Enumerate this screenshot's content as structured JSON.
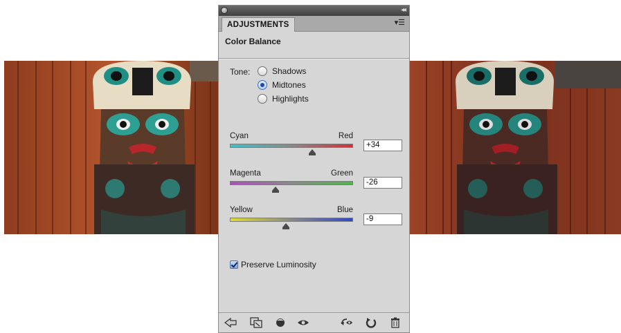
{
  "panel": {
    "tab_label": "ADJUSTMENTS",
    "section_title": "Color Balance",
    "tone_label": "Tone:",
    "tone_options": [
      "Shadows",
      "Midtones",
      "Highlights"
    ],
    "tone_selected": "Midtones",
    "sliders": [
      {
        "left": "Cyan",
        "right": "Red",
        "value": "+34",
        "level": 34,
        "colors": [
          "#3fc0c8",
          "#d0303a"
        ]
      },
      {
        "left": "Magenta",
        "right": "Green",
        "value": "-26",
        "level": -26,
        "colors": [
          "#b04cc0",
          "#4cb848"
        ]
      },
      {
        "left": "Yellow",
        "right": "Blue",
        "value": "-9",
        "level": -9,
        "colors": [
          "#e0dc28",
          "#3048c8"
        ]
      }
    ],
    "preserve_luminosity_label": "Preserve Luminosity",
    "preserve_luminosity_checked": true
  },
  "photos": {
    "left": "totem-pole-before",
    "right": "totem-pole-after"
  },
  "toolbar_icons": [
    "back-arrow-icon",
    "clip-to-layer-icon",
    "layer-visibility-icon",
    "eye-icon",
    "view-previous-state-icon",
    "reset-icon",
    "trash-icon"
  ]
}
